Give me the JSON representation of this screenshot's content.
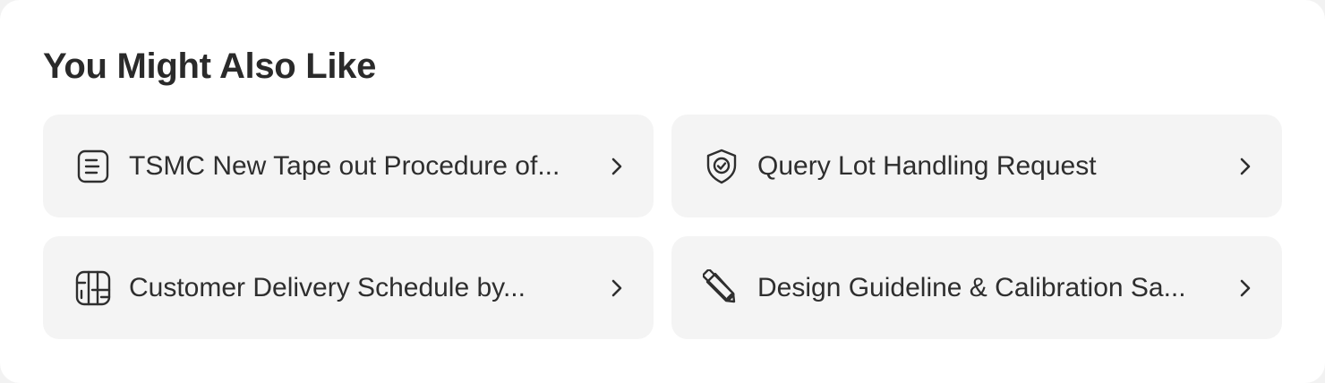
{
  "section": {
    "title": "You Might Also Like"
  },
  "cards": [
    {
      "label": "TSMC New Tape out Procedure of...",
      "icon": "document-icon"
    },
    {
      "label": "Query Lot Handling Request",
      "icon": "shield-check-icon"
    },
    {
      "label": "Customer Delivery Schedule by...",
      "icon": "schedule-board-icon"
    },
    {
      "label": "Design Guideline & Calibration Sa...",
      "icon": "ruler-pencil-icon"
    }
  ],
  "colors": {
    "card_background": "#f4f4f4",
    "text": "#2e2e2e",
    "title": "#2a2a2a"
  }
}
